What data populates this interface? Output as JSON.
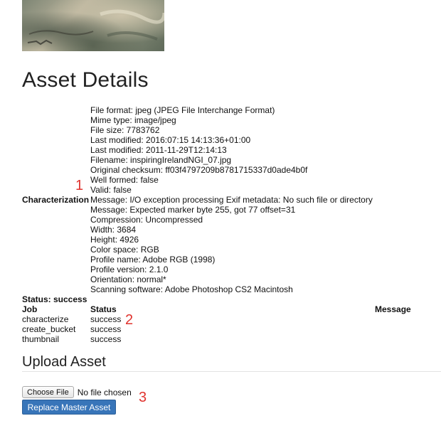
{
  "page": {
    "title": "Asset Details"
  },
  "characterization": {
    "label": "Characterization",
    "lines": [
      "File format: jpeg (JPEG File Interchange Format)",
      "Mime type: image/jpeg",
      "File size: 7783762",
      "Last modified: 2016:07:15 14:13:36+01:00",
      "Last modified: 2011-11-29T12:14:13",
      "Filename: inspiringIrelandNGI_07.jpg",
      "Original checksum: ff03f4797209b8781715337d0ade4b0f",
      "Well formed: false",
      "Valid: false",
      "Message: I/O exception processing Exif metadata: No such file or directory",
      "Message: Expected marker byte 255, got 77 offset=31",
      "Compression: Uncompressed",
      "Width: 3684",
      "Height: 4926",
      "Color space: RGB",
      "Profile name: Adobe RGB (1998)",
      "Profile version: 2.1.0",
      "Orientation: normal*",
      "Scanning software: Adobe Photoshop CS2 Macintosh"
    ]
  },
  "status": {
    "text": "Status: success"
  },
  "jobs": {
    "headers": {
      "job": "Job",
      "status": "Status",
      "message": "Message"
    },
    "rows": [
      {
        "job": "characterize",
        "status": "success",
        "message": ""
      },
      {
        "job": "create_bucket",
        "status": "success",
        "message": ""
      },
      {
        "job": "thumbnail",
        "status": "success",
        "message": ""
      }
    ]
  },
  "annotations": {
    "one": "1",
    "two": "2",
    "three": "3",
    "color": "#e0332e"
  },
  "upload": {
    "title": "Upload Asset",
    "choose_file_label": "Choose File",
    "file_status": "No file chosen",
    "replace_button_label": "Replace Master Asset",
    "button_color": "#3875b9"
  }
}
